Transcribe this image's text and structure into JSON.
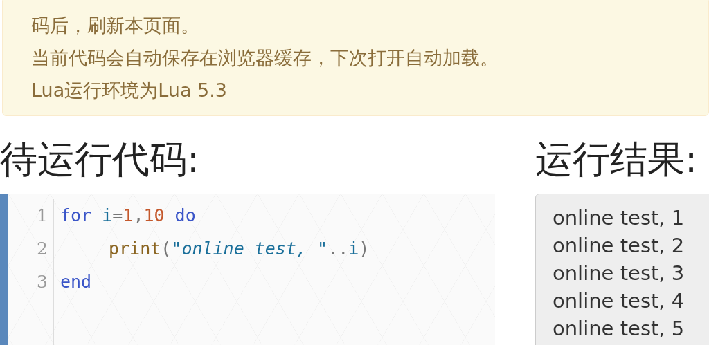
{
  "notice": {
    "lines": [
      "码后，刷新本页面。",
      "当前代码会自动保存在浏览器缓存，下次打开自动加载。",
      "Lua运行环境为Lua 5.3"
    ]
  },
  "editor": {
    "heading": "待运行代码:",
    "lines": [
      {
        "number": "1",
        "indent": false,
        "tokens": [
          {
            "kind": "keyword",
            "text": "for"
          },
          {
            "kind": "variable",
            "text": "i",
            "space_before": true
          },
          {
            "kind": "punct",
            "text": "="
          },
          {
            "kind": "number",
            "text": "1"
          },
          {
            "kind": "punct",
            "text": ","
          },
          {
            "kind": "number",
            "text": "10"
          },
          {
            "kind": "keyword",
            "text": "do",
            "space_before": true
          }
        ]
      },
      {
        "number": "2",
        "indent": true,
        "tokens": [
          {
            "kind": "function",
            "text": "print"
          },
          {
            "kind": "punct",
            "text": "("
          },
          {
            "kind": "string",
            "text": "\"online test, \""
          },
          {
            "kind": "punct",
            "text": ".."
          },
          {
            "kind": "variable",
            "text": "i"
          },
          {
            "kind": "punct",
            "text": ")"
          }
        ]
      },
      {
        "number": "3",
        "indent": false,
        "tokens": [
          {
            "kind": "keyword",
            "text": "end"
          }
        ]
      }
    ]
  },
  "output": {
    "heading": "运行结果:",
    "lines": [
      "online test, 1",
      "online test, 2",
      "online test, 3",
      "online test, 4",
      "online test, 5"
    ]
  }
}
